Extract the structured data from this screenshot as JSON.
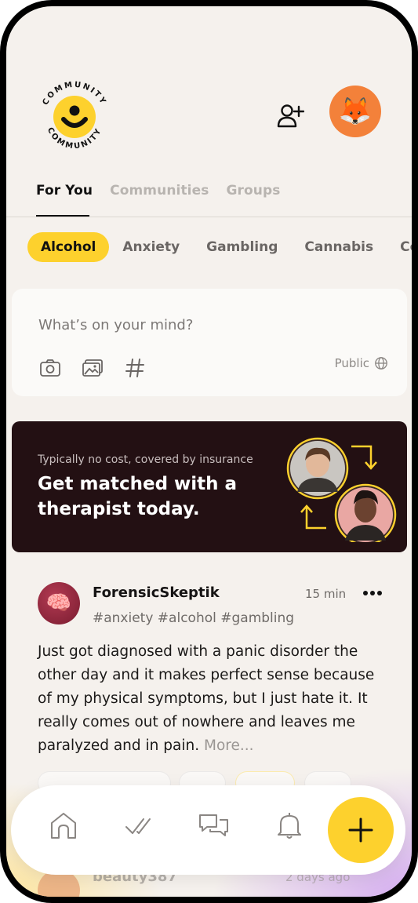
{
  "brand": {
    "logo_text": "COMMUNITY",
    "accent_color": "#fdd12d"
  },
  "header": {
    "add_user_icon": "add-user-icon",
    "avatar_emoji": "🦊"
  },
  "tabs": [
    {
      "label": "For You",
      "active": true
    },
    {
      "label": "Communities",
      "active": false
    },
    {
      "label": "Groups",
      "active": false
    }
  ],
  "chips": [
    {
      "label": "Alcohol",
      "active": true
    },
    {
      "label": "Anxiety",
      "active": false
    },
    {
      "label": "Gambling",
      "active": false
    },
    {
      "label": "Cannabis",
      "active": false
    },
    {
      "label": "Coc",
      "active": false
    }
  ],
  "composer": {
    "placeholder": "What’s on your mind?",
    "visibility": "Public"
  },
  "promo": {
    "subtitle": "Typically no cost, covered by insurance",
    "title": "Get matched with a therapist today."
  },
  "post": {
    "avatar_emoji": "🧠",
    "author": "ForensicSkeptik",
    "time": "15 min",
    "tags": "#anxiety #alcohol #gambling",
    "body": "Just got diagnosed with a panic disorder the other day and it makes perfect sense because of my physical symptoms, but I just hate it. It really comes out of nowhere and leaves me paralyzed and in pain.",
    "more": "More..."
  },
  "next_post": {
    "author": "beauty387",
    "time": "2 days ago"
  }
}
